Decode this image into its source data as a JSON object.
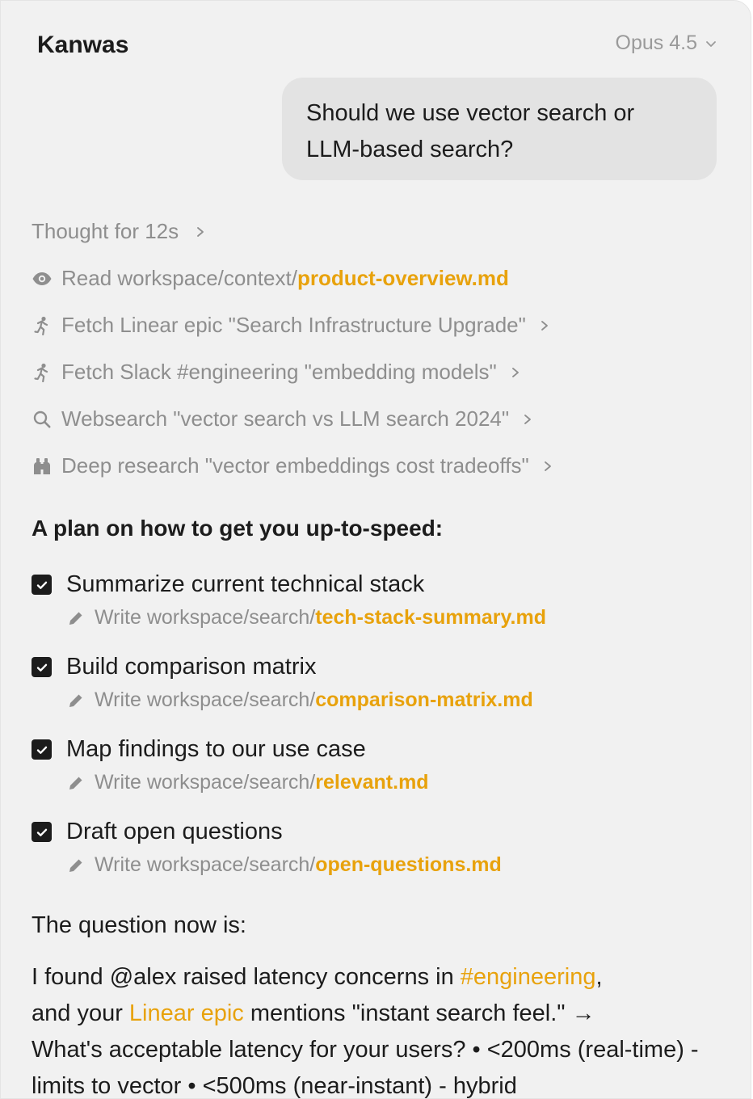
{
  "app": {
    "title": "Kanwas"
  },
  "model_select": {
    "label": "Opus 4.5"
  },
  "user_message": "Should we use vector search or LLM-based search?",
  "activity": {
    "thought": "Thought for 12s",
    "steps": [
      {
        "icon": "eye-icon",
        "prefix": "Read workspace/context/",
        "file": "product-overview.md",
        "text": ""
      },
      {
        "icon": "runner-icon",
        "prefix": "",
        "file": "",
        "text": "Fetch Linear epic \"Search Infrastructure Upgrade\""
      },
      {
        "icon": "runner-icon",
        "prefix": "",
        "file": "",
        "text": "Fetch Slack #engineering \"embedding models\""
      },
      {
        "icon": "search-icon",
        "prefix": "",
        "file": "",
        "text": "Websearch \"vector search vs LLM search 2024\""
      },
      {
        "icon": "binoculars-icon",
        "prefix": "",
        "file": "",
        "text": "Deep research \"vector embeddings cost tradeoffs\""
      }
    ]
  },
  "plan": {
    "title": "A plan on how to get you up-to-speed:",
    "tasks": [
      {
        "label": "Summarize current technical stack",
        "checked": true,
        "sub_prefix": "Write workspace/search/",
        "sub_file": "tech-stack-summary.md"
      },
      {
        "label": "Build comparison matrix",
        "checked": true,
        "sub_prefix": "Write workspace/search/",
        "sub_file": "comparison-matrix.md"
      },
      {
        "label": "Map findings to our use case",
        "checked": true,
        "sub_prefix": "Write workspace/search/",
        "sub_file": "relevant.md"
      },
      {
        "label": "Draft open questions",
        "checked": true,
        "sub_prefix": "Write workspace/search/",
        "sub_file": "open-questions.md"
      }
    ]
  },
  "question": {
    "title": "The question now is:",
    "p1": "I found @alex raised latency concerns in ",
    "link1": "#engineering",
    "p2": ",",
    "p3": "and your ",
    "link2": "Linear epic",
    "p4": " mentions \"instant search feel.\"  →",
    "p5": "What's acceptable latency for your users? • <200ms (real-time) - limits to vector • <500ms (near-instant) - hybrid"
  },
  "colors": {
    "accent": "#e8a20c",
    "text": "#1c1c1c",
    "muted": "#8e8e8e",
    "bubble": "#e3e3e3",
    "panel": "#f1f1f1"
  }
}
